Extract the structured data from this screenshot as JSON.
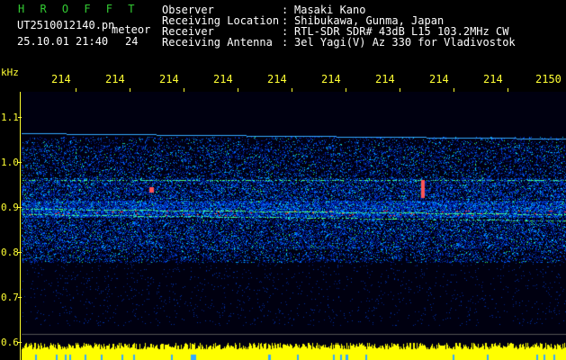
{
  "header": {
    "brand": "H R O F F T",
    "filename": "UT2510012140.pn",
    "mode": "meteor",
    "datetime": "25.10.01 21:40",
    "count": "24"
  },
  "meta": [
    {
      "key": "Observer",
      "sep": ":",
      "value": "Masaki Kano"
    },
    {
      "key": "Receiving Location",
      "sep": ":",
      "value": "Shibukawa, Gunma, Japan"
    },
    {
      "key": "Receiver",
      "sep": ":",
      "value": "RTL-SDR SDR# 43dB L15 103.2MHz CW"
    },
    {
      "key": "Receiving Antenna",
      "sep": ":",
      "value": "3el Yagi(V) Az 330 for Vladivostok"
    }
  ],
  "axes": {
    "y_unit": "kHz",
    "x_ticks": [
      "214",
      "214",
      "214",
      "214",
      "214",
      "214",
      "214",
      "214",
      "214",
      "2150"
    ],
    "y_ticks": [
      "1.1",
      "1.0",
      "0.9",
      "0.8",
      "0.7",
      "0.6"
    ]
  },
  "colors": {
    "label_yellow": "#ffff33",
    "brand_green": "#33cc33",
    "background": "#000000"
  }
}
